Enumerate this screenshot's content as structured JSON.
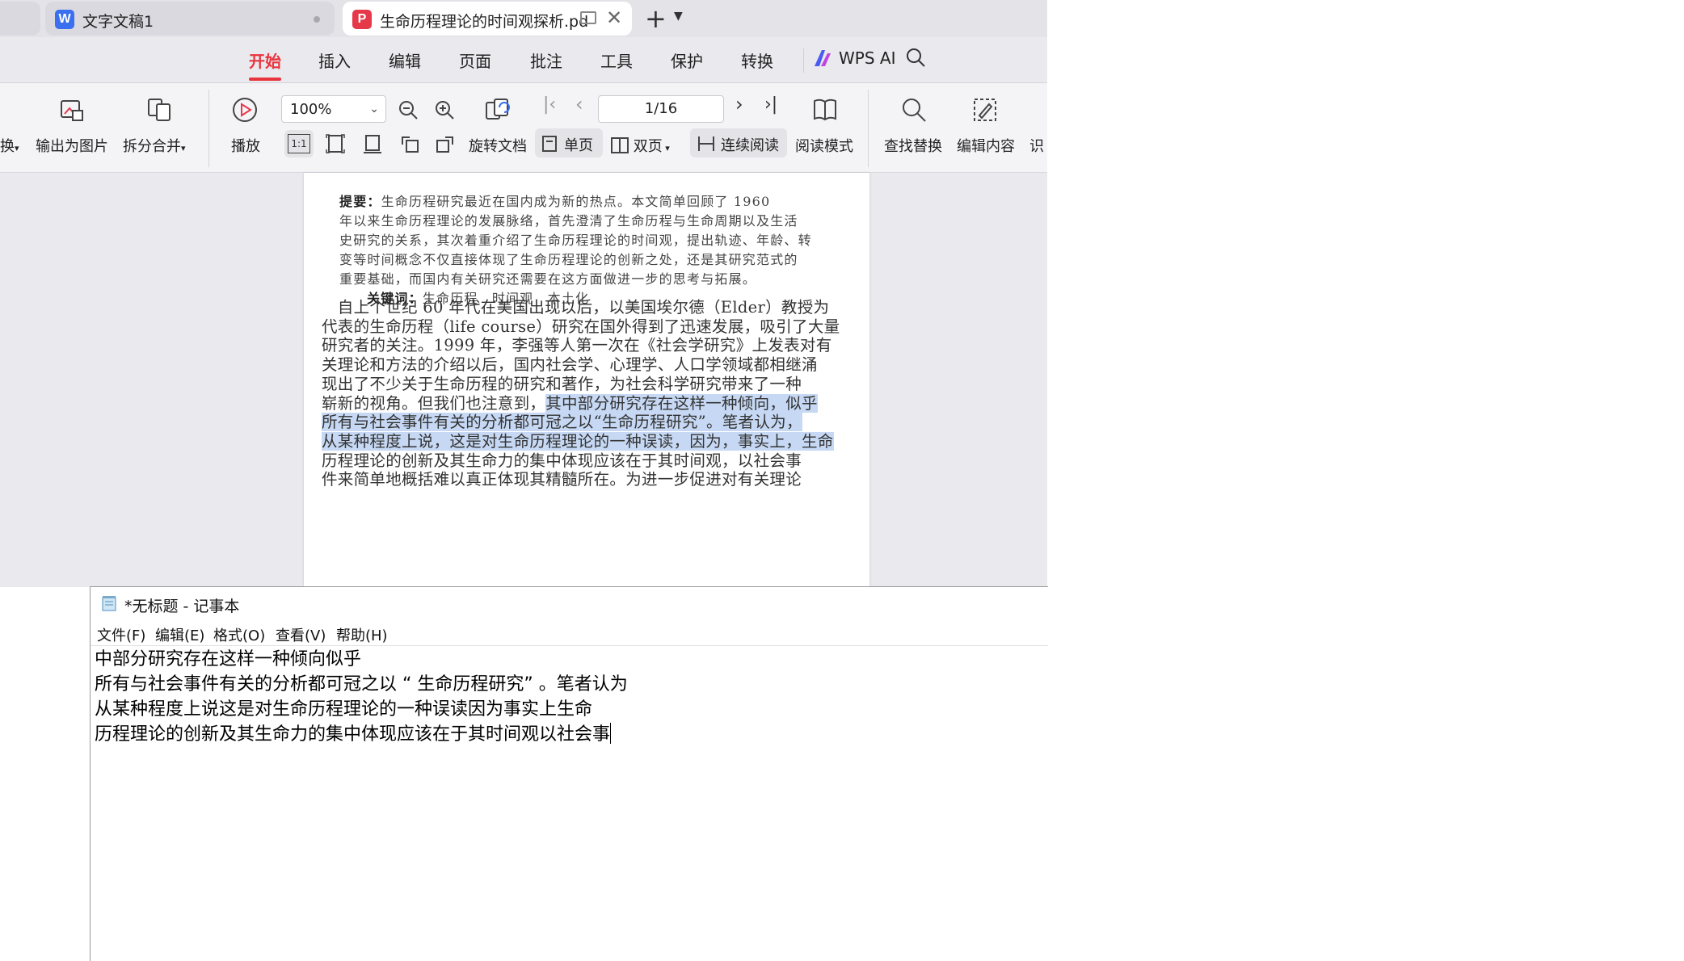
{
  "tabs": {
    "doc1": {
      "label": "文字文稿1",
      "icon": "W"
    },
    "pdf": {
      "label": "生命历程理论的时间观探析.pd",
      "icon": "P"
    },
    "new_tab": "+"
  },
  "menu": {
    "items": [
      "开始",
      "插入",
      "编辑",
      "页面",
      "批注",
      "工具",
      "保护",
      "转换"
    ],
    "ai": "WPS AI",
    "active_color": "#e8343d"
  },
  "toolbar": {
    "cut_left": "换",
    "export_image": "输出为图片",
    "split_merge": "拆分合并",
    "play": "播放",
    "zoom": "100%",
    "rotate": "旋转文档",
    "page": "1/16",
    "single": "单页",
    "double": "双页",
    "continuous": "连续阅读",
    "read_mode": "阅读模式",
    "find_replace": "查找替换",
    "edit_content": "编辑内容",
    "cut_right": "识",
    "actual_size_icon": "1:1"
  },
  "document": {
    "abstract": [
      "提要：生命历程研究最近在国内成为新的热点。本文简单回顾了 1960",
      "年以来生命历程理论的发展脉络，首先澄清了生命历程与生命周期以及生活",
      "史研究的关系，其次着重介绍了生命历程理论的时间观，提出轨迹、年龄、转",
      "变等时间概念不仅直接体现了生命历程理论的创新之处，还是其研究范式的",
      "重要基础，而国内有关研究还需要在这方面做进一步的思考与拓展。",
      "关键词：生命历程　时间观　本土化"
    ],
    "body": [
      {
        "plain": "　自上个世纪 60 年代在美国出现以后，以美国埃尔德（Elder）教授为",
        "hl": ""
      },
      {
        "plain": "代表的生命历程（life course）研究在国外得到了迅速发展，吸引了大量",
        "hl": ""
      },
      {
        "plain": "研究者的关注。1999 年，李强等人第一次在《社会学研究》上发表对有",
        "hl": ""
      },
      {
        "plain": "关理论和方法的介绍以后，国内社会学、心理学、人口学领域都相继涌",
        "hl": ""
      },
      {
        "plain": "现出了不少关于生命历程的研究和著作，为社会科学研究带来了一种",
        "hl": ""
      },
      {
        "plain": "崭新的视角。但我们也注意到，",
        "hl": "其中部分研究存在这样一种倾向，似乎"
      },
      {
        "plain": "",
        "hl": "所有与社会事件有关的分析都可冠之以“生命历程研究”。笔者认为，"
      },
      {
        "plain": "",
        "hl": "从某种程度上说，这是对生命历程理论的一种误读，因为，事实上，生命"
      },
      {
        "plain": "历程理论的创新及其生命力的集中体现应该在于其时间观，以社会事",
        "hl": ""
      },
      {
        "plain": "件来简单地概括难以真正体现其精髓所在。为进一步促进对有关理论",
        "hl": ""
      }
    ],
    "highlight_color": "#c6d8f3"
  },
  "notepad": {
    "title": "*无标题 - 记事本",
    "menu": [
      "文件(F)",
      "编辑(E)",
      "格式(O)",
      "查看(V)",
      "帮助(H)"
    ],
    "lines": [
      "中部分研究存在这样一种倾向似乎",
      "所有与社会事件有关的分析都可冠之以 “ 生命历程研究” 。笔者认为",
      "从某种程度上说这是对生命历程理论的一种误读因为事实上生命",
      "历程理论的创新及其生命力的集中体现应该在于其时间观以社会事"
    ]
  }
}
